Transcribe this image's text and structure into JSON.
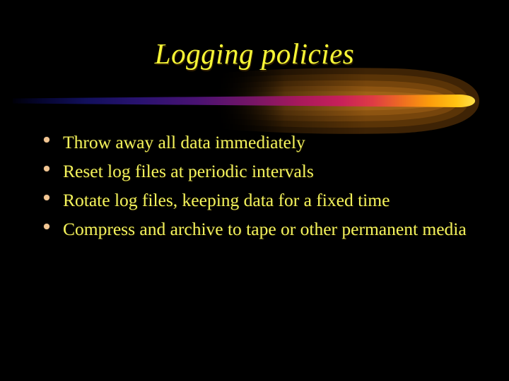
{
  "slide": {
    "title": "Logging policies",
    "background_color": "#000000",
    "title_color": "#F7F736",
    "body_text_color": "#F2F25C",
    "bullet_marker_color": "#F2C693",
    "bullets": [
      {
        "text": "Throw away all data immediately",
        "wraps": false
      },
      {
        "text": "Reset log files at periodic intervals",
        "wraps": false
      },
      {
        "text": "Rotate log files, keeping data for a fixed time",
        "wraps": true
      },
      {
        "text": "Compress and archive to tape or other permanent media",
        "wraps": true
      }
    ],
    "divider": {
      "name": "comet-swoosh",
      "core_gradient": [
        "#05052E",
        "#171166",
        "#3A1070",
        "#6B1466",
        "#A8195C",
        "#D4285A",
        "#E8552E",
        "#FF9A10",
        "#FFD21A"
      ],
      "glow_colors": [
        "#4A2A05",
        "#6B3C08",
        "#8B5410",
        "#A06418"
      ]
    }
  }
}
